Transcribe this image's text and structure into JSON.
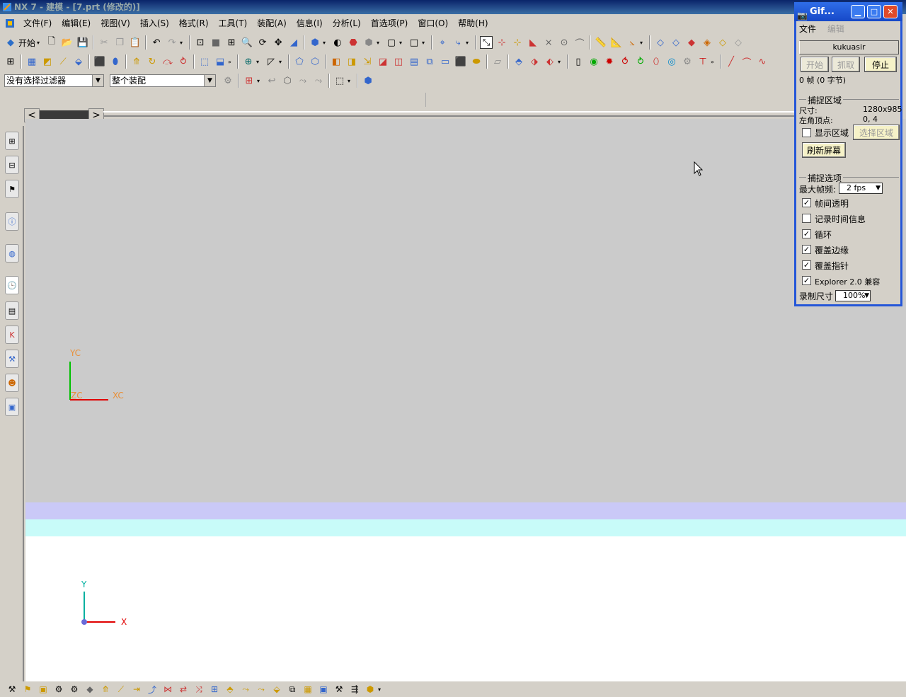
{
  "window": {
    "title": "NX 7 - 建模 - [7.prt (修改的)]"
  },
  "menu": [
    "文件(F)",
    "编辑(E)",
    "视图(V)",
    "插入(S)",
    "格式(R)",
    "工具(T)",
    "装配(A)",
    "信息(I)",
    "分析(L)",
    "首选项(P)",
    "窗口(O)",
    "帮助(H)"
  ],
  "toolbar": {
    "start_label": "开始"
  },
  "filters": {
    "selection_filter": "没有选择过滤器",
    "assembly_scope": "整个装配"
  },
  "viewport": {
    "wcs": {
      "y": "YC",
      "x": "XC",
      "z": "ZC"
    },
    "abs": {
      "y": "Y",
      "x": "X"
    }
  },
  "gif_tool": {
    "title": "Gif...",
    "menu": {
      "file": "文件",
      "edit": "编辑"
    },
    "author": "kukuasir",
    "buttons": {
      "start": "开始",
      "capture": "抓取",
      "stop": "停止"
    },
    "status": "0 帧 (0 字节)",
    "capture_area": {
      "heading": "捕捉区域",
      "size_label": "尺寸:",
      "size_value": "1280x985",
      "corner_label": "左角顶点:",
      "corner_value": "0, 4",
      "show_area": "显示区域",
      "select_area": "选择区域",
      "refresh": "刷新屏幕"
    },
    "capture_options": {
      "heading": "捕捉选项",
      "max_fps_label": "最大帧频:",
      "max_fps_value": "2 fps",
      "frame_transparent": "帧间透明",
      "record_time": "记录时间信息",
      "loop": "循环",
      "cover_edge": "覆盖边缘",
      "cover_pointer": "覆盖指针",
      "explorer_compat": "Explorer 2.0 兼容",
      "record_size_label": "录制尺寸",
      "record_size_value": "100%"
    }
  },
  "colors": {
    "graphics_bg": "#cbcbcb",
    "band_purple": "#cac9f7",
    "band_cyan": "#c8fbf9",
    "gif_title": "#2456d8"
  }
}
